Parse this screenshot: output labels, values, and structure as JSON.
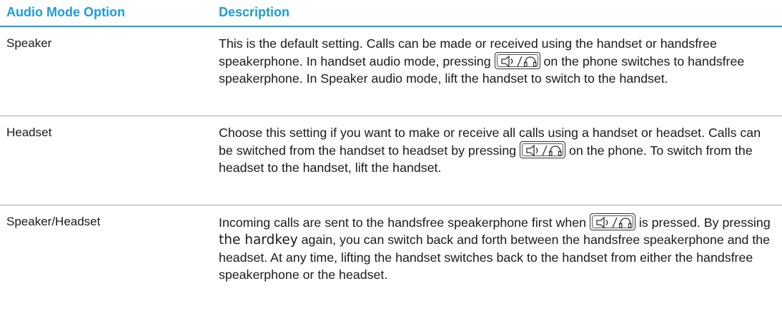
{
  "header": {
    "col_option": "Audio Mode Option",
    "col_description": "Description"
  },
  "rows": [
    {
      "option": "Speaker",
      "desc_a": "This is the default setting. Calls can be made or received using the handset or handsfree speakerphone. In handset audio mode, pressing",
      "desc_b": "on the phone switches to handsfree speakerphone. In Speaker audio mode, lift the handset to switch to the handset."
    },
    {
      "option": "Headset",
      "desc_a": "Choose this setting if you want to make or receive all calls using a handset or headset. Calls can be switched from the handset to headset by pressing",
      "desc_b": "on the phone. To switch from the headset to the handset, lift the handset."
    },
    {
      "option": "Speaker/Headset",
      "desc_a": "Incoming calls are sent to the handsfree speakerphone first when",
      "desc_b": "is pressed. By pressing",
      "desc_hardkey": "the hardkey",
      "desc_c": "again, you can switch back and forth between the handsfree speakerphone and the headset. At any time, lifting the handset switches back to the handset from either the handsfree speakerphone or the headset."
    }
  ],
  "key_icon": "speaker-headset-key-icon",
  "colors": {
    "header_text": "#1f9bd6",
    "header_rule": "#1f9bd6",
    "row_rule": "#a8a8a8",
    "body_text": "#1a1a1a"
  }
}
